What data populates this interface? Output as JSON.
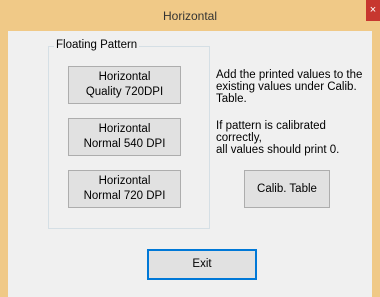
{
  "window": {
    "title": "Horizontal",
    "close_glyph": "×"
  },
  "group": {
    "label": "Floating Pattern",
    "buttons": [
      {
        "line1": "Horizontal",
        "line2": "Quality 720DPI"
      },
      {
        "line1": "Horizontal",
        "line2": "Normal 540 DPI"
      },
      {
        "line1": "Horizontal",
        "line2": "Normal 720 DPI"
      }
    ]
  },
  "info": {
    "line1": "Add the printed values to the",
    "line2": "existing values under Calib.",
    "line3": "Table.",
    "line4": "If pattern is calibrated correctly,",
    "line5": "all values should print 0."
  },
  "buttons": {
    "calib_table": "Calib. Table",
    "exit": "Exit"
  },
  "colors": {
    "title_bar": "#f0c987",
    "close_button": "#c7372f",
    "dialog_face": "#f0f0f0",
    "button_face": "#e1e1e1",
    "focus_border": "#0078d7"
  }
}
